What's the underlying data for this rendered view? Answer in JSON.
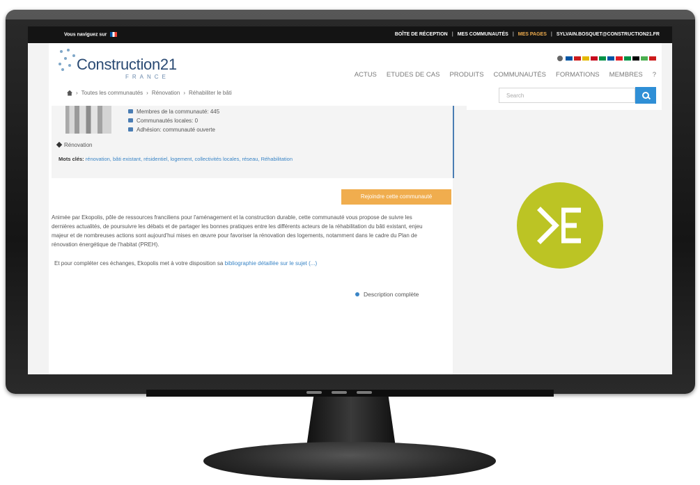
{
  "topbar": {
    "browse_label": "Vous naviguez sur",
    "inbox": "BOÎTE DE RÉCEPTION",
    "communities": "MES COMMUNAUTÉS",
    "pages": "MES PAGES",
    "user_email": "SYLVAIN.BOSQUET@CONSTRUCTION21.FR"
  },
  "brand": {
    "name": "Construction21",
    "country": "FRANCE"
  },
  "nav": {
    "items": [
      "ACTUS",
      "ETUDES DE CAS",
      "PRODUITS",
      "COMMUNAUTÉS",
      "FORMATIONS",
      "MEMBRES",
      "?"
    ]
  },
  "languages": {
    "flag_colors": [
      "#0055a4",
      "#cc1b1b",
      "#e4b800",
      "#c60b1e",
      "#009246",
      "#0055a4",
      "#e41e26",
      "#009246",
      "#000000",
      "#4caf50",
      "#cc1b1b"
    ]
  },
  "breadcrumb": [
    "Toutes les communautés",
    "Rénovation",
    "Réhabiliter le bâti"
  ],
  "search": {
    "placeholder": "Search"
  },
  "community": {
    "stats": [
      "Membres de la communauté: 445",
      "Communautés locales: 0",
      "Adhésion: communauté ouverte"
    ],
    "tag": "Rénovation",
    "keywords_label": "Mots clés:",
    "keywords": "rénovation, bâti existant, résidentiel, logement, collectivités locales, réseau, Réhabilitation",
    "join_button": "Rejoindre cette communauté",
    "description": "Animée par Ekopolis, pôle de ressources franciliens pour l'aménagement et la construction durable, cette communauté vous propose de suivre les dernières actualités, de poursuivre les débats et de partager les bonnes pratiques entre les différents acteurs de la réhabilitation du bâti existant, enjeu majeur et de nombreuses actions sont aujourd'hui mises en œuvre pour favoriser la rénovation des logements, notamment dans le cadre du Plan de rénovation énergétique de l'habitat (PREH).",
    "description2_text": "Et pour compléter ces échanges, Ekopolis met à votre disposition sa",
    "description2_link": "bibliographie détaillée sur le sujet (...)",
    "full_description": "Description complète"
  },
  "colors": {
    "accent": "#f0ad4e",
    "link": "#3a85c6",
    "logo_circle": "#bcc424",
    "search_button": "#2f8fd6"
  }
}
